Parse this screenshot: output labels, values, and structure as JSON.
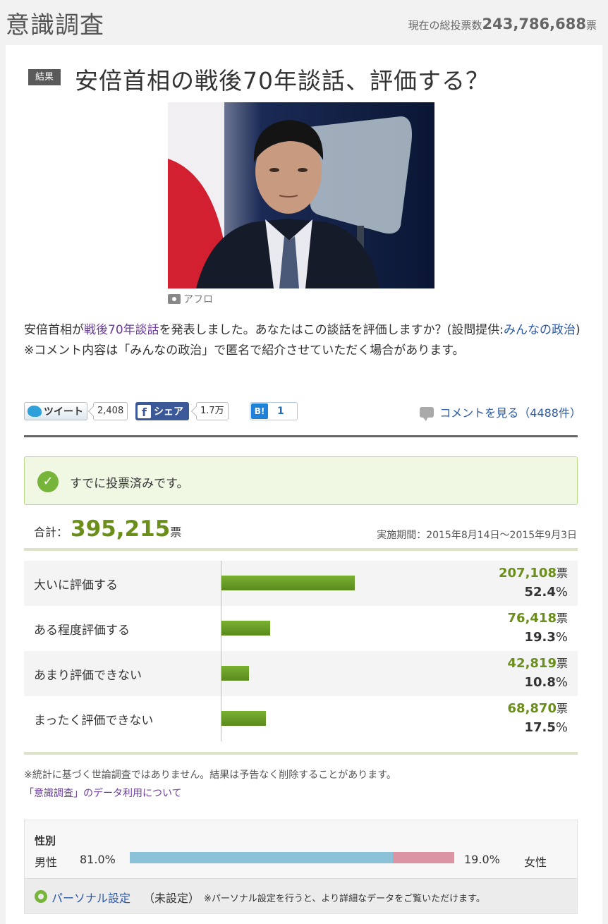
{
  "header": {
    "title": "意識調査",
    "total_label": "現在の総投票数",
    "total_value": "243,786,688",
    "total_unit": "票"
  },
  "question": {
    "badge": "結果",
    "title": "安倍首相の戦後70年談話、評価する？",
    "photo_credit": "アフロ",
    "desc_1": "安倍首相が",
    "desc_link": "戦後70年談話",
    "desc_2": "を発表しました。あなたはこの談話を評価しますか？(設問提供:",
    "desc_provider": "みんなの政治",
    "desc_3": ")",
    "desc_note": "※コメント内容は「みんなの政治」で匿名で紹介させていただく場合があります。"
  },
  "social": {
    "tweet_label": "ツイート",
    "tweet_count": "2,408",
    "share_label": "シェア",
    "share_count": "1.7万",
    "hatena_logo": "B!",
    "hatena_count": "1",
    "comments_label": "コメントを見る（4488件）"
  },
  "voted_message": "すでに投票済みです。",
  "summary": {
    "total_label": "合計：",
    "total_votes": "395,215",
    "total_unit": "票",
    "period": "実施期間：2015年8月14日〜2015年9月3日"
  },
  "results": [
    {
      "label": "大いに評価する",
      "votes": "207,108",
      "unit": "票",
      "pct": "52.4",
      "pct_unit": "%",
      "share": 52.4
    },
    {
      "label": "ある程度評価する",
      "votes": "76,418",
      "unit": "票",
      "pct": "19.3",
      "pct_unit": "%",
      "share": 19.3
    },
    {
      "label": "あまり評価できない",
      "votes": "42,819",
      "unit": "票",
      "pct": "10.8",
      "pct_unit": "%",
      "share": 10.8
    },
    {
      "label": "まったく評価できない",
      "votes": "68,870",
      "unit": "票",
      "pct": "17.5",
      "pct_unit": "%",
      "share": 17.5
    }
  ],
  "notes": {
    "disclaimer": "※統計に基づく世論調査ではありません。結果は予告なく削除することがあります。",
    "data_link": "「意識調査」のデータ利用について"
  },
  "gender": {
    "title": "性別",
    "male_label": "男性",
    "male_pct": "81.0%",
    "male_share": 81.0,
    "female_pct": "19.0%",
    "female_share": 19.0,
    "female_label": "女性"
  },
  "personal": {
    "link": "パーソナル設定",
    "state": "（未設定）",
    "note": "※パーソナル設定を行うと、より詳細なデータをご覧いただけます。"
  },
  "colors": {
    "accent_green": "#6a8e1a",
    "bar_green": "#5a8a1e",
    "male": "#8cc2d8",
    "female": "#dc93a4"
  }
}
